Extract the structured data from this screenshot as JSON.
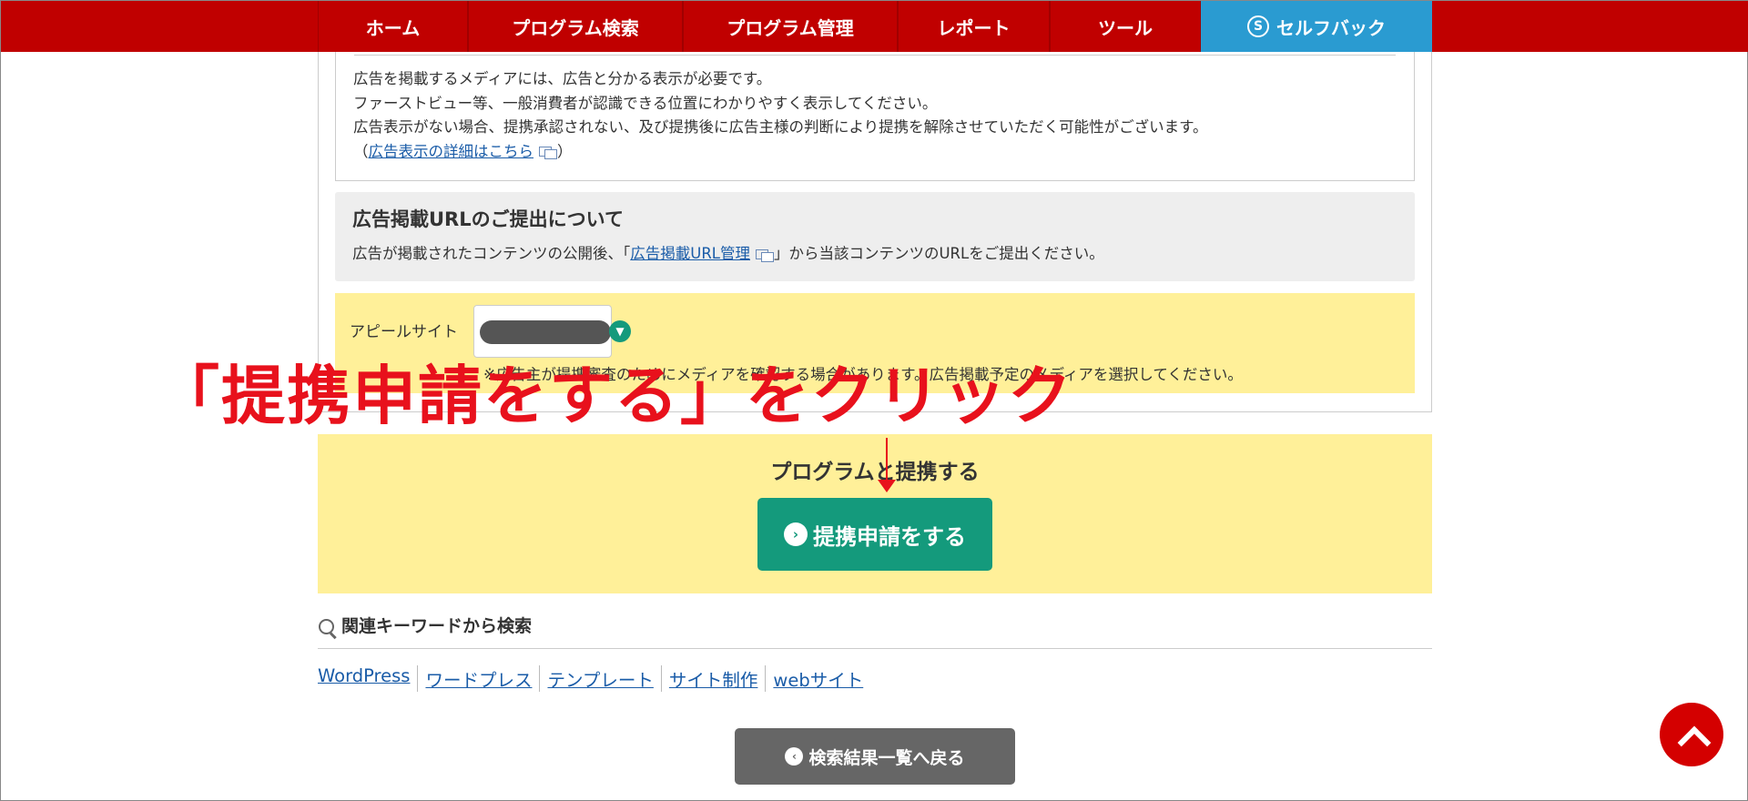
{
  "nav": {
    "items": [
      {
        "label": "ホーム"
      },
      {
        "label": "プログラム検索"
      },
      {
        "label": "プログラム管理"
      },
      {
        "label": "レポート"
      },
      {
        "label": "ツール"
      }
    ],
    "self_back": {
      "label": "セルフバック",
      "icon": "s-circle-icon"
    }
  },
  "notice": {
    "line1": "広告を掲載するメディアには、広告と分かる表示が必要です。",
    "line2": "ファーストビュー等、一般消費者が認識できる位置にわかりやすく表示してください。",
    "line3": "広告表示がない場合、提携承認されない、及び提携後に広告主様の判断により提携を解除させていただく可能性がございます。",
    "link_open": "（",
    "link_label": "広告表示の詳細はこちら",
    "link_close": "）"
  },
  "url_section": {
    "title": "広告掲載URLのご提出について",
    "text_before": "広告が掲載されたコンテンツの公開後、「",
    "link_label": "広告掲載URL管理",
    "text_after": "」から当該コンテンツのURLをご提出ください。"
  },
  "appeal": {
    "label": "アピールサイト",
    "note": "※広告主が提携審査のためにメディアを確認する場合があります。広告掲載予定のメディアを選択してください。"
  },
  "annotation": {
    "text": "「提携申請をする」をクリック",
    "color": "#e8111c"
  },
  "apply": {
    "title": "プログラムと提携する",
    "button_label": "提携申請をする"
  },
  "keywords": {
    "title": "関連キーワードから検索",
    "tags": [
      "WordPress",
      "ワードプレス",
      "テンプレート",
      "サイト制作",
      "webサイト"
    ]
  },
  "back_button": {
    "label": "検索結果一覧へ戻る"
  },
  "colors": {
    "header_red": "#c00000",
    "self_back_blue": "#2a9bd1",
    "apply_green": "#149a7c",
    "highlight_yellow": "#fff099",
    "pagetop_red": "#d40000"
  }
}
